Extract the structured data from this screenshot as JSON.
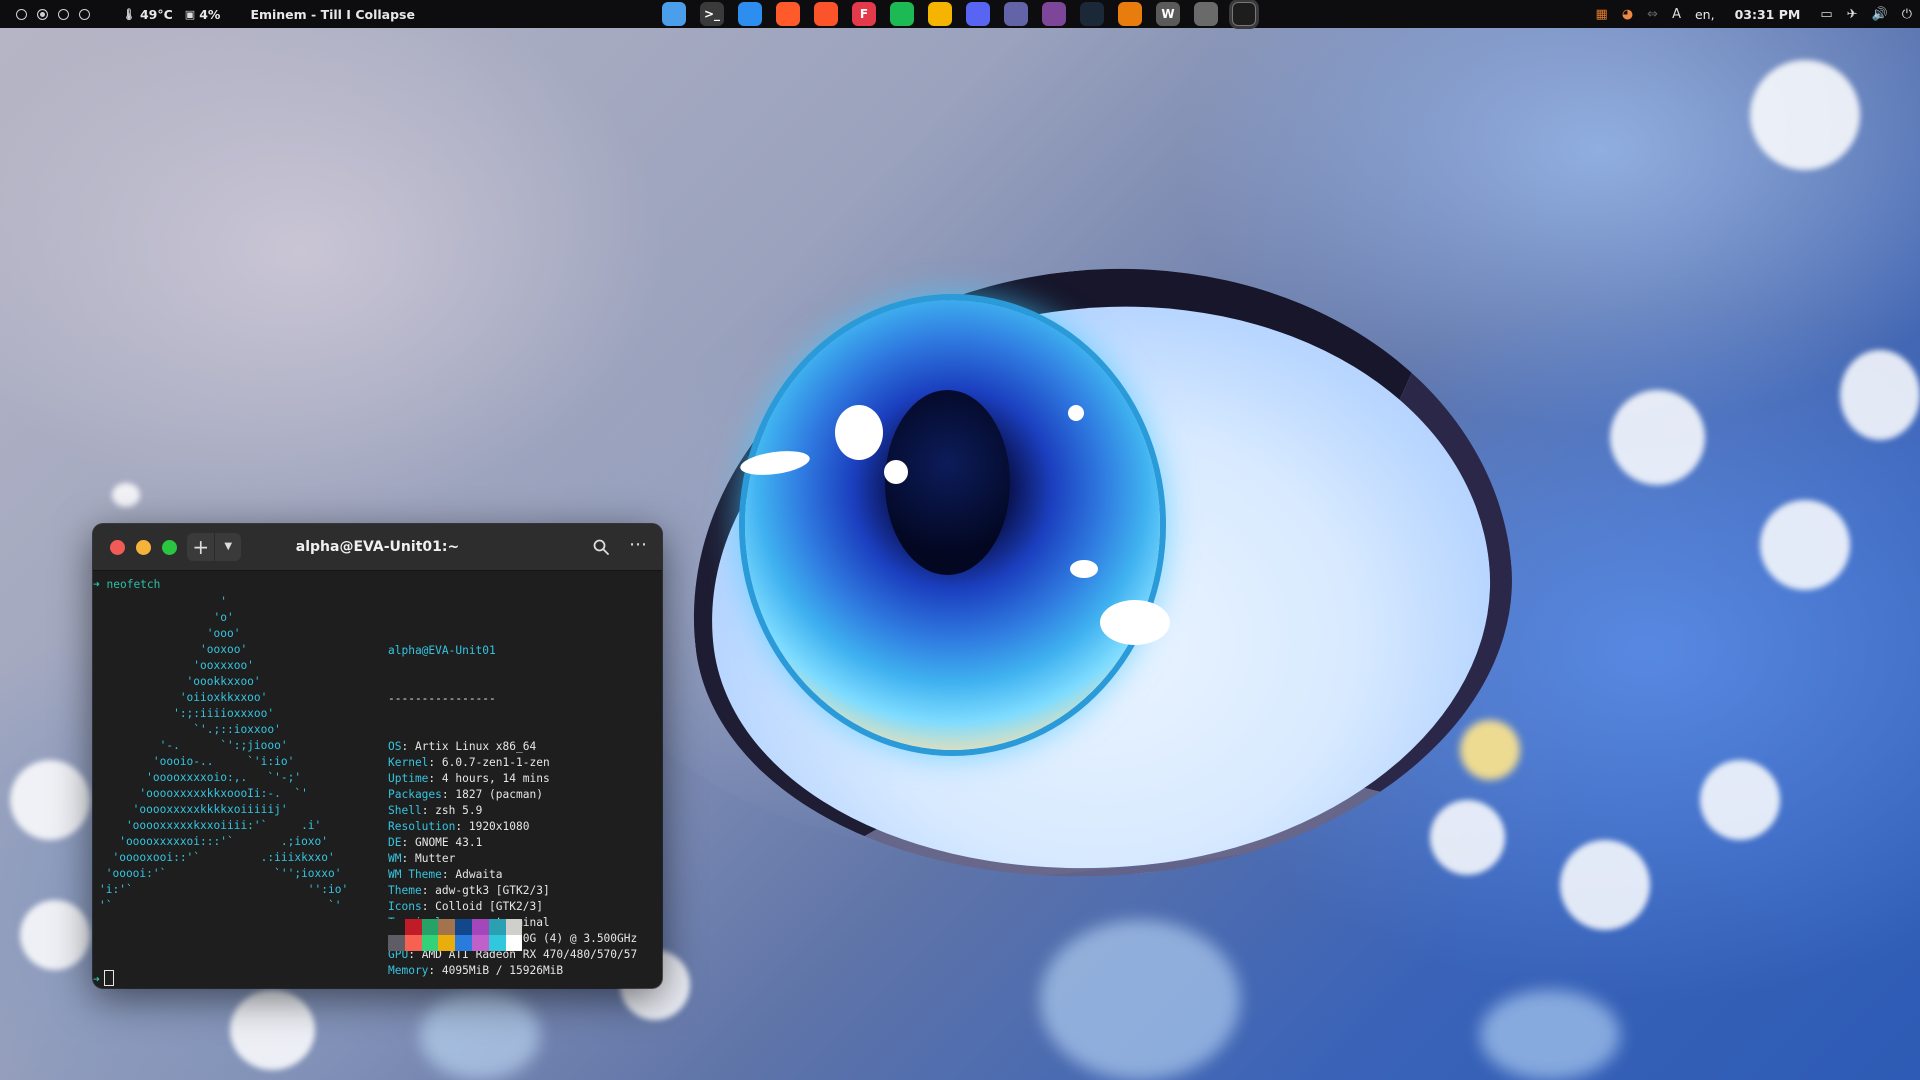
{
  "topbar": {
    "workspaces": [
      "1",
      "2",
      "3",
      "4"
    ],
    "active_workspace": 2,
    "temperature": "49°C",
    "battery": "4%",
    "now_playing": "Eminem - Till I Collapse",
    "dock_apps": [
      {
        "name": "files-icon",
        "color": "#4a9eea",
        "glyph": ""
      },
      {
        "name": "terminal-app-icon",
        "color": "#3a3a3a",
        "glyph": ">_"
      },
      {
        "name": "safari-icon",
        "color": "#2d8ef0",
        "glyph": ""
      },
      {
        "name": "firefox-icon",
        "color": "#ff5a2a",
        "glyph": ""
      },
      {
        "name": "brave-icon",
        "color": "#fb542b",
        "glyph": ""
      },
      {
        "name": "flathub-icon",
        "color": "#e23a4a",
        "glyph": "F"
      },
      {
        "name": "spotify-icon",
        "color": "#1db954",
        "glyph": ""
      },
      {
        "name": "lollypop-icon",
        "color": "#f4b400",
        "glyph": ""
      },
      {
        "name": "discord-icon",
        "color": "#5865f2",
        "glyph": ""
      },
      {
        "name": "teams-icon",
        "color": "#6264a7",
        "glyph": ""
      },
      {
        "name": "tor-icon",
        "color": "#7d4698",
        "glyph": ""
      },
      {
        "name": "steam-icon",
        "color": "#1b2838",
        "glyph": ""
      },
      {
        "name": "blender-icon",
        "color": "#e87d0d",
        "glyph": ""
      },
      {
        "name": "vmware-icon",
        "color": "#5a5a5a",
        "glyph": "W"
      },
      {
        "name": "timeshift-icon",
        "color": "#6a6a6a",
        "glyph": ""
      },
      {
        "name": "gnome-terminal-icon",
        "color": "#1d1d1d",
        "glyph": ""
      }
    ],
    "language": "en,",
    "time": "03:31 PM"
  },
  "terminal": {
    "title": "alpha@EVA-Unit01:~",
    "command": "neofetch",
    "ascii_art": "                  '\n                 'o'\n                'ooo'\n               'ooxoo'\n              'ooxxxoo'\n             'oookkxxoo'\n            'oiioxkkxxoo'\n           ':;:iiiioxxxoo'\n              `'.;::ioxxoo'\n         '-.      `':;jiooo'\n        'oooio-..     `'i:io'\n       'ooooxxxxoio:,.   `'-;'\n      'ooooxxxxxkkxoooIi:-.  `'\n     'ooooxxxxxkkkkxoiiiiij'\n    'ooooxxxxxkxxoiiii:'`     .i'\n   'ooooxxxxxoi:::'`       .;ioxo'\n  'ooooxooi::'`         .:iiixkxxo'\n 'ooooi:'`                `'';ioxxo'\n'i:'`                          '':io'\n'`                                `'",
    "header": "alpha@EVA-Unit01",
    "separator": "----------------",
    "info": [
      {
        "key": "OS",
        "value": "Artix Linux x86_64"
      },
      {
        "key": "Kernel",
        "value": "6.0.7-zen1-1-zen"
      },
      {
        "key": "Uptime",
        "value": "4 hours, 14 mins"
      },
      {
        "key": "Packages",
        "value": "1827 (pacman)"
      },
      {
        "key": "Shell",
        "value": "zsh 5.9"
      },
      {
        "key": "Resolution",
        "value": "1920x1080"
      },
      {
        "key": "DE",
        "value": "GNOME 43.1"
      },
      {
        "key": "WM",
        "value": "Mutter"
      },
      {
        "key": "WM Theme",
        "value": "Adwaita"
      },
      {
        "key": "Theme",
        "value": "adw-gtk3 [GTK2/3]"
      },
      {
        "key": "Icons",
        "value": "Colloid [GTK2/3]"
      },
      {
        "key": "Terminal",
        "value": "gnome-terminal"
      },
      {
        "key": "CPU",
        "value": "AMD Ryzen 3 2200G (4) @ 3.500GHz"
      },
      {
        "key": "GPU",
        "value": "AMD ATI Radeon RX 470/480/570/57"
      },
      {
        "key": "Memory",
        "value": "4095MiB / 15926MiB"
      }
    ],
    "palette_top": [
      "#1e1e1e",
      "#c01c28",
      "#26a269",
      "#a2734c",
      "#12488b",
      "#a347ba",
      "#2aa1b3",
      "#d0cfcc"
    ],
    "palette_bottom": [
      "#5e5c64",
      "#f66151",
      "#33d17a",
      "#e9ad0c",
      "#2a7bde",
      "#c061cb",
      "#33c7de",
      "#ffffff"
    ]
  }
}
